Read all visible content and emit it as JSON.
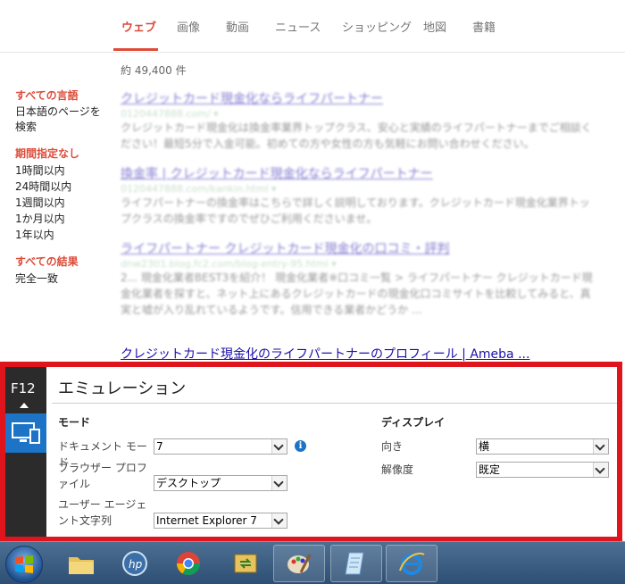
{
  "tabs": [
    {
      "label": "ウェブ",
      "active": true
    },
    {
      "label": "画像"
    },
    {
      "label": "動画"
    },
    {
      "label": "ニュース"
    },
    {
      "label": "ショッピング"
    },
    {
      "label": "地図"
    },
    {
      "label": "書籍"
    }
  ],
  "result_count": "約 49,400 件",
  "filters": {
    "language": {
      "heading": "すべての言語",
      "items": [
        "日本語のページを検索"
      ]
    },
    "period": {
      "heading": "期間指定なし",
      "items": [
        "1時間以内",
        "24時間以内",
        "1週間以内",
        "1か月以内",
        "1年以内"
      ]
    },
    "results": {
      "heading": "すべての結果",
      "items": [
        "完全一致"
      ]
    }
  },
  "results": [
    {
      "title": "クレジットカード現金化ならライフパートナー",
      "url": "0120447888.com/ ▾",
      "snippet": "クレジットカード現金化は換金率業界トップクラス、安心と実績のライフパートナーまでご相談ください！最短5分で入金可能。初めての方や女性の方も気軽にお問い合わせください。"
    },
    {
      "title": "換金率 | クレジットカード現金化ならライフパートナー",
      "url": "0120447888.com/kankin.html ▾",
      "snippet": "ライフパートナーの換金率はこちらで詳しく説明しております。クレジットカード現金化業界トップクラスの換金率ですのでぜひご利用くださいませ。"
    },
    {
      "title": "ライフパートナー クレジットカード現金化の口コミ・評判",
      "url": "dnw23tl1.blog.fc2.com/blog-entry-95.html ▾",
      "snippet": "2... 現金化業者BEST3を紹介！ 現金化業者※口コミ一覧 > ライフパートナー クレジットカード現金化業者を探すと、ネット上にあるクレジットカードの現金化口コミサイトを比較してみると、真実と嘘が入り乱れているようです。信用できる業者かどうか ..."
    }
  ],
  "last_result_title": "クレジットカード現金化のライフパートナーのプロフィール | Ameba ...",
  "devtools": {
    "f12_label": "F12",
    "panel_title": "エミュレーション",
    "mode": {
      "heading": "モード",
      "document_mode": {
        "label": "ドキュメント モード",
        "value": "7"
      },
      "browser_profile": {
        "label": "ブラウザー プロファイル",
        "value": "デスクトップ"
      },
      "user_agent": {
        "label": "ユーザー エージェント文字列",
        "value": "Internet Explorer 7"
      }
    },
    "display": {
      "heading": "ディスプレイ",
      "orientation": {
        "label": "向き",
        "value": "横"
      },
      "resolution": {
        "label": "解像度",
        "value": "既定"
      }
    }
  },
  "taskbar": {
    "icons": [
      "start-orb-icon",
      "file-explorer-icon",
      "hp-icon",
      "chrome-icon",
      "sync-folder-icon",
      "paint-icon",
      "notepad-icon",
      "internet-explorer-icon"
    ]
  },
  "colors": {
    "accent_red": "#dd4b39",
    "frame_red": "#e0141d",
    "emulation_blue": "#1d74c7",
    "link_blue": "#1a0dab"
  }
}
